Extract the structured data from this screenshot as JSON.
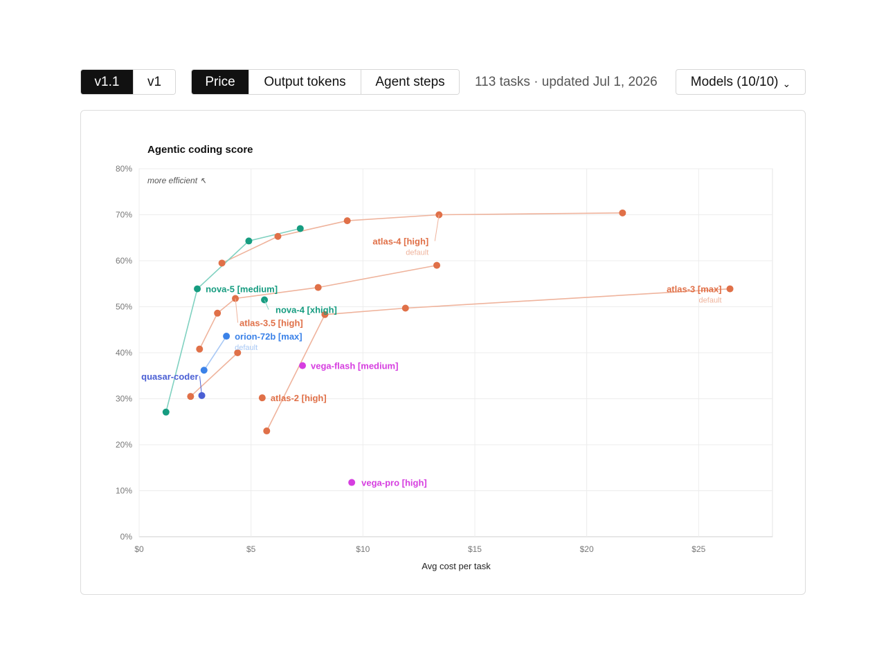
{
  "version_toggle": {
    "options": [
      "v1.1",
      "v1"
    ],
    "active": "v1.1"
  },
  "metric_toggle": {
    "options": [
      "Price",
      "Output tokens",
      "Agent steps"
    ],
    "active": "Price"
  },
  "status_text": "113 tasks · updated Jul 1, 2026",
  "models_button": {
    "label": "Models (10/10)",
    "icon": "chevron-down-icon"
  },
  "chart_data": {
    "type": "scatter",
    "title": "Agentic coding score",
    "annotation": "more efficient ↖",
    "xlabel": "Avg cost per task",
    "ylabel": "",
    "xlim": [
      0,
      28.3
    ],
    "ylim": [
      0,
      80
    ],
    "xticks": [
      0,
      5,
      10,
      15,
      20,
      25
    ],
    "xtick_labels": [
      "$0",
      "$5",
      "$10",
      "$15",
      "$20",
      "$25"
    ],
    "yticks": [
      0,
      10,
      20,
      30,
      40,
      50,
      60,
      70,
      80
    ],
    "ytick_labels": [
      "0%",
      "10%",
      "20%",
      "30%",
      "40%",
      "50%",
      "60%",
      "70%",
      "80%"
    ],
    "grid": true,
    "series": [
      {
        "name": "atlas-4 [high]",
        "sublabel": "default",
        "color": "#e07048",
        "line": true,
        "points": [
          [
            3.7,
            59.5
          ],
          [
            6.2,
            65.3
          ],
          [
            9.3,
            68.7
          ],
          [
            13.4,
            70.0
          ],
          [
            21.6,
            70.4
          ]
        ]
      },
      {
        "name": "atlas-3 [max]",
        "sublabel": "default",
        "color": "#e07048",
        "line": true,
        "points": [
          [
            5.7,
            23.0
          ],
          [
            8.3,
            48.3
          ],
          [
            11.9,
            49.7
          ],
          [
            26.4,
            53.9
          ]
        ]
      },
      {
        "name": "atlas-3.5 [high]",
        "sublabel": "",
        "color": "#e07048",
        "line": true,
        "points": [
          [
            2.7,
            40.8
          ],
          [
            3.5,
            48.6
          ],
          [
            4.3,
            51.8
          ],
          [
            8.0,
            54.2
          ],
          [
            13.3,
            59.0
          ]
        ]
      },
      {
        "name": "atlas-2 [high]",
        "sublabel": "",
        "color": "#e07048",
        "line": true,
        "points": [
          [
            2.3,
            30.5
          ],
          [
            4.4,
            40.0
          ]
        ]
      },
      {
        "name": "atlas-2 [high]",
        "sublabel": "",
        "color": "#e07048",
        "line": false,
        "points": [
          [
            5.5,
            30.2
          ]
        ]
      },
      {
        "name": "nova-5 [medium]",
        "sublabel": "",
        "color": "#169c80",
        "line": true,
        "points": [
          [
            1.2,
            27.1
          ],
          [
            2.6,
            53.9
          ],
          [
            4.9,
            64.3
          ],
          [
            7.2,
            67.0
          ]
        ]
      },
      {
        "name": "nova-4 [xhigh]",
        "sublabel": "",
        "color": "#169c80",
        "line": false,
        "points": [
          [
            5.6,
            51.5
          ]
        ]
      },
      {
        "name": "orion-72b [max]",
        "sublabel": "default",
        "color": "#3b82e8",
        "line": true,
        "points": [
          [
            2.9,
            36.2
          ],
          [
            3.9,
            43.6
          ]
        ]
      },
      {
        "name": "quasar-coder",
        "sublabel": "",
        "color": "#4a5fd4",
        "line": false,
        "points": [
          [
            2.8,
            30.7
          ]
        ]
      },
      {
        "name": "vega-flash [medium]",
        "sublabel": "",
        "color": "#d63ee0",
        "line": false,
        "points": [
          [
            7.3,
            37.2
          ]
        ]
      },
      {
        "name": "vega-pro [high]",
        "sublabel": "",
        "color": "#d63ee0",
        "line": false,
        "points": [
          [
            9.5,
            11.8
          ]
        ]
      }
    ]
  }
}
